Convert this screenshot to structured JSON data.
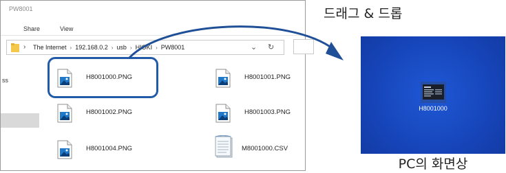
{
  "explorer": {
    "title": "PW8001",
    "ribbon_tabs": [
      "Share",
      "View"
    ],
    "address": {
      "breadcrumb": [
        "The Internet",
        "192.168.0.2",
        "usb",
        "HIOKI",
        "PW8001"
      ]
    },
    "nav_partial_text": "ss",
    "files": [
      {
        "name": "H8001000.PNG",
        "icon": "image-file-icon"
      },
      {
        "name": "H8001001.PNG",
        "icon": "image-file-icon"
      },
      {
        "name": "H8001002.PNG",
        "icon": "image-file-icon"
      },
      {
        "name": "H8001003.PNG",
        "icon": "image-file-icon"
      },
      {
        "name": "H8001004.PNG",
        "icon": "image-file-icon"
      },
      {
        "name": "M8001000.CSV",
        "icon": "csv-file-icon"
      }
    ]
  },
  "drag_drop_label": "드래그 & 드롭",
  "desktop": {
    "file_label": "H8001000",
    "caption": "PC의 화면상"
  },
  "colors": {
    "highlight": "#215aa8",
    "desktop_blue": "#1644b8",
    "image_icon_blue": "#1f78c8"
  }
}
